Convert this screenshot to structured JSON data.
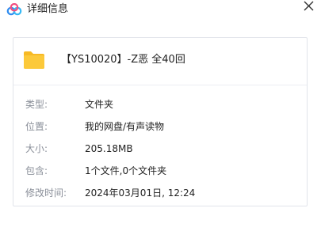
{
  "window": {
    "title": "详细信息",
    "app_icon": "baidu-netdisk-logo",
    "close_icon": "close-icon"
  },
  "file": {
    "icon": "folder-icon",
    "icon_color": "#f9c230",
    "name": "【YS10020】-Z恶 全40回"
  },
  "details": [
    {
      "label": "类型:",
      "value": "文件夹"
    },
    {
      "label": "位置:",
      "value": "我的网盘/有声读物"
    },
    {
      "label": "大小:",
      "value": "205.18MB"
    },
    {
      "label": "包含:",
      "value": "1个文件,0个文件夹"
    },
    {
      "label": "修改时间:",
      "value": "2024年03月01日, 12:24"
    }
  ],
  "colors": {
    "label": "#8a8f99",
    "value": "#222222",
    "border": "#e1e4ea",
    "logo_blue": "#2f8cf0",
    "logo_pink": "#f04f80"
  }
}
